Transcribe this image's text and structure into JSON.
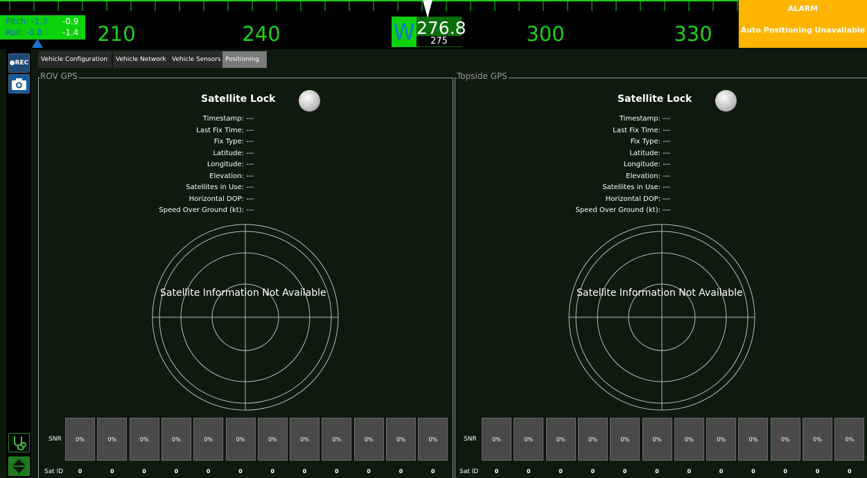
{
  "heading": {
    "scale_labels": [
      "210",
      "240",
      "300",
      "330"
    ],
    "direction": "W",
    "value": "276.8",
    "target": "275"
  },
  "attitude": {
    "pitch_label": "Pitch:",
    "pitch_value": "-1.3",
    "pitch_value_2": "-0.9",
    "roll_label": "Roll:",
    "roll_value": "-0.8",
    "roll_value_2": "-1.4"
  },
  "alarm": {
    "title": "ALARM",
    "message": "Auto Positioning Unavailable",
    "color": "#ffb400"
  },
  "left_bar": {
    "rec_label": "●REC",
    "camera_icon": "camera-icon",
    "health_icon": "stethoscope-icon",
    "collapse_icon": "collapse-arrows-icon"
  },
  "tabs": [
    "Vehicle Configuration",
    "Vehicle Network",
    "Vehicle Sensors",
    "Positioning"
  ],
  "panels": [
    {
      "title": "ROV GPS",
      "lock_label": "Satellite Lock",
      "info": [
        {
          "k": "Timestamp:",
          "v": "---"
        },
        {
          "k": "Last Fix Time:",
          "v": "---"
        },
        {
          "k": "Fix Type:",
          "v": "---"
        },
        {
          "k": "Latitude:",
          "v": "---"
        },
        {
          "k": "Longitude:",
          "v": "---"
        },
        {
          "k": "Elevation:",
          "v": "---"
        },
        {
          "k": "Satellites in Use:",
          "v": "---"
        },
        {
          "k": "Horizontal DOP:",
          "v": "---"
        },
        {
          "k": "Speed Over Ground (kt):",
          "v": "---"
        }
      ],
      "radar_message": "Satellite Information Not Available",
      "snr_label": "SNR",
      "satid_label": "Sat ID",
      "snr": [
        "0%",
        "0%",
        "0%",
        "0%",
        "0%",
        "0%",
        "0%",
        "0%",
        "0%",
        "0%",
        "0%",
        "0%"
      ],
      "satid": [
        "0",
        "0",
        "0",
        "0",
        "0",
        "0",
        "0",
        "0",
        "0",
        "0",
        "0",
        "0"
      ]
    },
    {
      "title": "Topside GPS",
      "lock_label": "Satellite Lock",
      "info": [
        {
          "k": "Timestamp:",
          "v": "---"
        },
        {
          "k": "Last Fix Time:",
          "v": "---"
        },
        {
          "k": "Fix Type:",
          "v": "---"
        },
        {
          "k": "Latitude:",
          "v": "---"
        },
        {
          "k": "Longitude:",
          "v": "---"
        },
        {
          "k": "Elevation:",
          "v": "---"
        },
        {
          "k": "Satellites in Use:",
          "v": "---"
        },
        {
          "k": "Horizontal DOP:",
          "v": "---"
        },
        {
          "k": "Speed Over Ground (kt):",
          "v": "---"
        }
      ],
      "radar_message": "Satellite Information Not Available",
      "snr_label": "SNR",
      "satid_label": "Sat ID",
      "snr": [
        "0%",
        "0%",
        "0%",
        "0%",
        "0%",
        "0%",
        "0%",
        "0%",
        "0%",
        "0%",
        "0%",
        "0%"
      ],
      "satid": [
        "0",
        "0",
        "0",
        "0",
        "0",
        "0",
        "0",
        "0",
        "0",
        "0",
        "0",
        "0"
      ]
    }
  ]
}
